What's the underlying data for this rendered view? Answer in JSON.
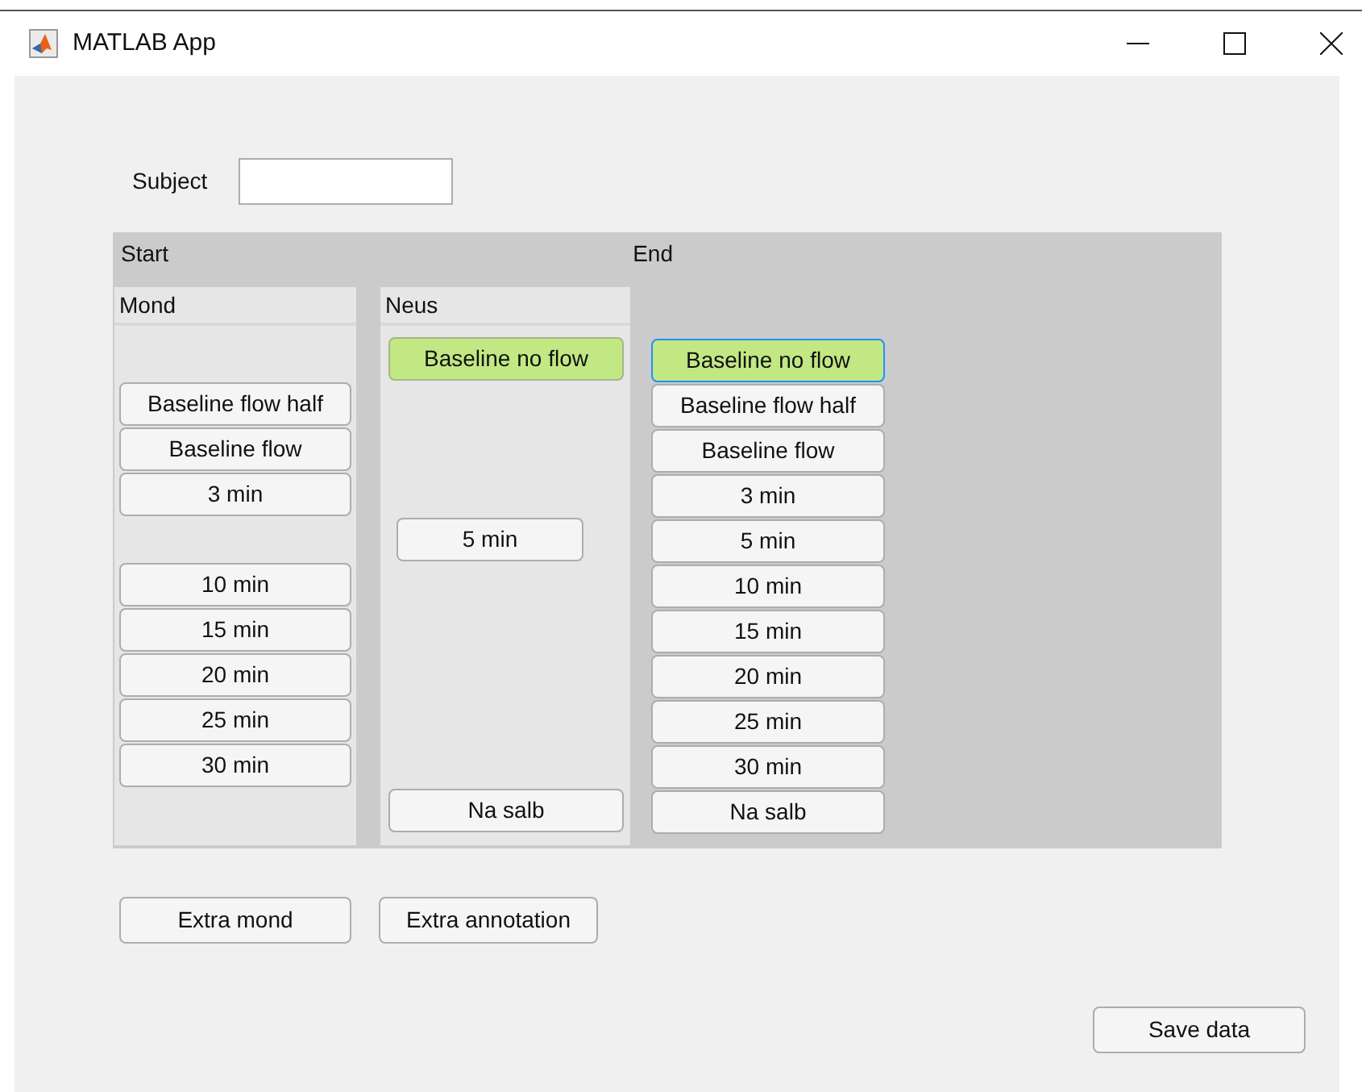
{
  "window": {
    "title": "MATLAB App"
  },
  "subject": {
    "label": "Subject"
  },
  "panel": {
    "start_label": "Start",
    "end_label": "End",
    "columns": [
      {
        "title": "Mond",
        "items": [
          {
            "kind": "gap"
          },
          {
            "kind": "button",
            "label": "Baseline flow half",
            "done": false,
            "focused": false
          },
          {
            "kind": "button",
            "label": "Baseline flow",
            "done": false,
            "focused": false
          },
          {
            "kind": "button",
            "label": "3 min",
            "done": false,
            "focused": false
          },
          {
            "kind": "gap"
          },
          {
            "kind": "button",
            "label": "10 min",
            "done": false,
            "focused": false
          },
          {
            "kind": "button",
            "label": "15 min",
            "done": false,
            "focused": false
          },
          {
            "kind": "button",
            "label": "20 min",
            "done": false,
            "focused": false
          },
          {
            "kind": "button",
            "label": "25 min",
            "done": false,
            "focused": false
          },
          {
            "kind": "button",
            "label": "30 min",
            "done": false,
            "focused": false
          }
        ]
      },
      {
        "title": "Neus",
        "items": [
          {
            "kind": "button",
            "label": "Baseline no flow",
            "done": true,
            "focused": false
          },
          {
            "kind": "gap"
          },
          {
            "kind": "gap"
          },
          {
            "kind": "gap"
          },
          {
            "kind": "short-button",
            "label": "5 min",
            "done": false,
            "focused": false
          },
          {
            "kind": "gap"
          },
          {
            "kind": "gap"
          },
          {
            "kind": "gap"
          },
          {
            "kind": "gap"
          },
          {
            "kind": "gap"
          },
          {
            "kind": "button",
            "label": "Na salb",
            "done": false,
            "focused": false
          }
        ]
      }
    ],
    "end_items": [
      {
        "kind": "button",
        "label": "Baseline no flow",
        "done": true,
        "focused": true
      },
      {
        "kind": "button",
        "label": "Baseline flow half",
        "done": false,
        "focused": false
      },
      {
        "kind": "button",
        "label": "Baseline flow",
        "done": false,
        "focused": false
      },
      {
        "kind": "button",
        "label": "3 min",
        "done": false,
        "focused": false
      },
      {
        "kind": "button",
        "label": "5 min",
        "done": false,
        "focused": false
      },
      {
        "kind": "button",
        "label": "10 min",
        "done": false,
        "focused": false
      },
      {
        "kind": "button",
        "label": "15 min",
        "done": false,
        "focused": false
      },
      {
        "kind": "button",
        "label": "20 min",
        "done": false,
        "focused": false
      },
      {
        "kind": "button",
        "label": "25 min",
        "done": false,
        "focused": false
      },
      {
        "kind": "button",
        "label": "30 min",
        "done": false,
        "focused": false
      },
      {
        "kind": "button",
        "label": "Na salb",
        "done": false,
        "focused": false
      }
    ]
  },
  "extra_buttons": [
    "Extra mond",
    "Extra annotation"
  ],
  "save_button": "Save data"
}
